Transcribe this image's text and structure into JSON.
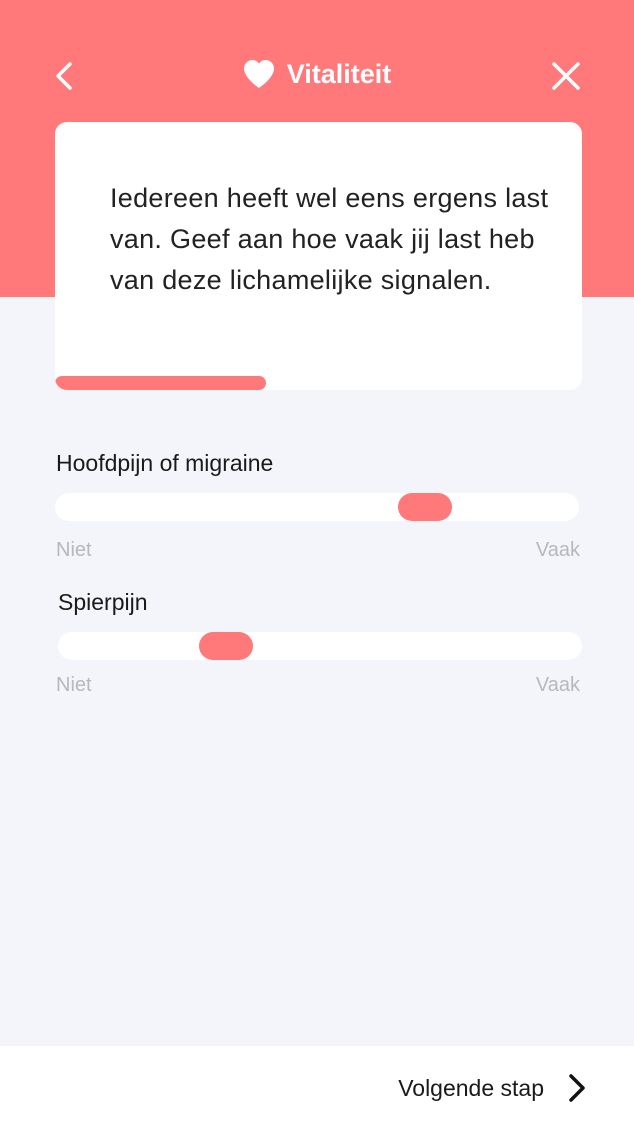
{
  "header": {
    "title": "Vitaliteit",
    "back_icon": "chevron-left-icon",
    "heart_icon": "heart-icon",
    "close_icon": "close-icon",
    "bg_color": "#ff787a"
  },
  "intro_card": {
    "text": "Iedereen heeft wel eens ergens last van. Geef aan hoe vaak jij last heb van deze lichamelijke signalen.",
    "progress": 0.4
  },
  "questions": [
    {
      "label": "Hoofdpijn of migraine",
      "min_label": "Niet",
      "max_label": "Vaak",
      "value": 0.73
    },
    {
      "label": "Spierpijn",
      "min_label": "Niet",
      "max_label": "Vaak",
      "value": 0.3
    }
  ],
  "footer": {
    "next_label": "Volgende stap",
    "next_icon": "chevron-right-icon"
  },
  "colors": {
    "accent": "#ff787a",
    "background": "#f4f5fa",
    "muted_text": "#b7b8bd"
  }
}
